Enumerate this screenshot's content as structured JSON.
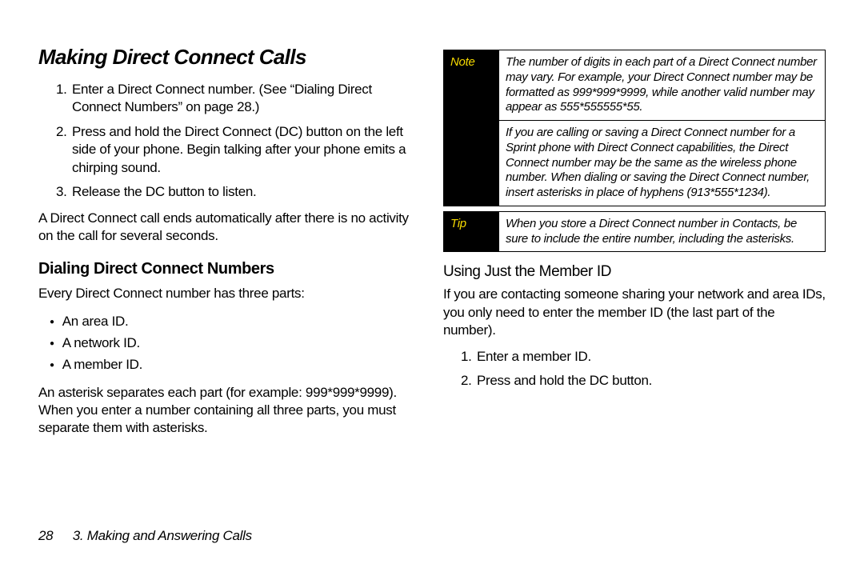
{
  "title": "Making Direct Connect Calls",
  "steps_main": [
    "Enter a Direct Connect number. (See “Dialing Direct Connect Numbers” on page 28.)",
    "Press and hold the Direct Connect (DC) button on the left side of your phone. Begin talking after your phone emits a chirping sound.",
    "Release the DC button to listen."
  ],
  "para_after_steps": "A Direct Connect call ends automatically after there is no activity on the call for several seconds.",
  "h2_dialing": "Dialing Direct Connect Numbers",
  "para_dialing_intro": "Every Direct Connect number has three parts:",
  "bullets": [
    "An area ID.",
    "A network ID.",
    "A member ID."
  ],
  "para_asterisk": "An asterisk separates each part (for example: 999*999*9999). When you enter a number containing all three parts, you must separate them with asterisks.",
  "note_label": "Note",
  "note_body_1": "The number of digits in each part of a Direct Connect number may vary. For example, your Direct Connect number may be formatted as 999*999*9999, while another valid number may appear as 555*555555*55.",
  "note_body_2": "If you are calling or saving a Direct Connect number for a Sprint phone with Direct Connect capabilities, the Direct Connect number may be the same as the wireless phone number. When dialing or saving the Direct Connect number, insert asterisks in place of hyphens (913*555*1234).",
  "tip_label": "Tip",
  "tip_body": "When you store a Direct Connect number in Contacts, be sure to include the entire number, including the asterisks.",
  "h3_member": "Using Just the Member ID",
  "para_member": "If you are contacting someone sharing your network and area IDs, you only need to enter the member ID (the last part of the number).",
  "steps_member": [
    "Enter a member ID.",
    "Press and hold the DC button."
  ],
  "footer_page": "28",
  "footer_chapter": "3. Making and Answering Calls"
}
